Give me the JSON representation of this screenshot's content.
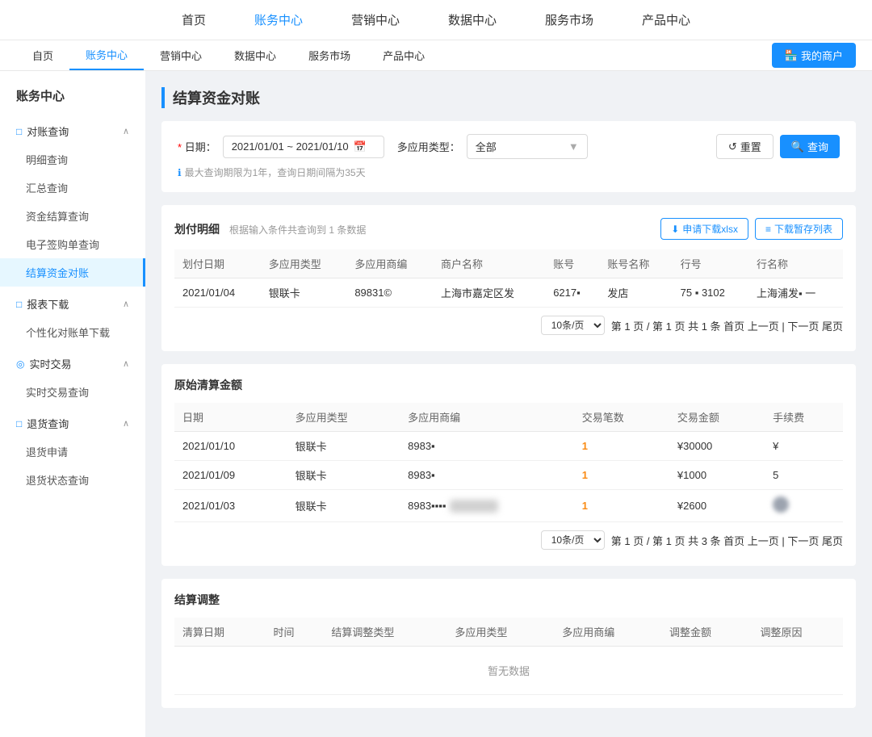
{
  "topNav": {
    "main": [
      {
        "label": "首页",
        "active": false
      },
      {
        "label": "账务中心",
        "active": true
      },
      {
        "label": "营销中心",
        "active": false
      },
      {
        "label": "数据中心",
        "active": false
      },
      {
        "label": "服务市场",
        "active": false
      },
      {
        "label": "产品中心",
        "active": false
      }
    ],
    "sub": [
      {
        "label": "自页",
        "active": false
      },
      {
        "label": "账务中心",
        "active": true
      },
      {
        "label": "营销中心",
        "active": false
      },
      {
        "label": "数据中心",
        "active": false
      },
      {
        "label": "服务市场",
        "active": false
      },
      {
        "label": "产品中心",
        "active": false
      }
    ],
    "myMerchantLabel": "我的商户"
  },
  "sidebar": {
    "title": "账务中心",
    "groups": [
      {
        "icon": "□",
        "label": "对账查询",
        "items": [
          {
            "label": "明细查询",
            "active": false
          },
          {
            "label": "汇总查询",
            "active": false
          },
          {
            "label": "资金结算查询",
            "active": false
          },
          {
            "label": "电子签购单查询",
            "active": false
          },
          {
            "label": "结算资金对账",
            "active": true
          }
        ]
      },
      {
        "icon": "□",
        "label": "报表下载",
        "items": [
          {
            "label": "个性化对账单下载",
            "active": false
          }
        ]
      },
      {
        "icon": "◎",
        "label": "实时交易",
        "items": [
          {
            "label": "实时交易查询",
            "active": false
          }
        ]
      },
      {
        "icon": "□",
        "label": "退货查询",
        "items": [
          {
            "label": "退货申请",
            "active": false
          },
          {
            "label": "退货状态查询",
            "active": false
          }
        ]
      }
    ]
  },
  "page": {
    "title": "结算资金对账",
    "filter": {
      "dateLabel": "日期：",
      "dateRequired": true,
      "dateValue": "2021/01/01 ~ 2021/01/10",
      "appTypeLabel": "多应用类型：",
      "appTypeValue": "全部",
      "hint": "最大查询期限为1年，查询日期间隔为35天",
      "resetLabel": "重置",
      "queryLabel": "查询"
    },
    "paymentDetail": {
      "title": "划付明细",
      "subtitle": "根据输入条件共查询到 1 条数据",
      "downloadXlsxLabel": "申请下载xlsx",
      "downloadSaveLabel": "下载暂存列表",
      "columns": [
        "划付日期",
        "多应用类型",
        "多应用商编",
        "商户名称",
        "账号",
        "账号名称",
        "行号",
        "行名称"
      ],
      "rows": [
        {
          "date": "2021/01/04",
          "appType": "银联卡",
          "appCode": "89831©",
          "merchantName": "上海市嘉定区发",
          "accountNo": "6217▪",
          "accountName": "发店",
          "bankCode": "75  ▪  3102",
          "bankName": "上海浦发▪  一"
        }
      ],
      "pagination": {
        "perPage": "10条/页",
        "info": "第 1 页 / 第 1 页 共 1 条 首页 上一页 | 下一页 尾页"
      }
    },
    "originalSettlement": {
      "title": "原始清算金额",
      "columns": [
        "日期",
        "多应用类型",
        "多应用商编",
        "交易笔数",
        "交易金额",
        "手续费"
      ],
      "rows": [
        {
          "date": "2021/01/10",
          "appType": "银联卡",
          "appCode": "8983▪",
          "tradeCount": "1",
          "tradeAmount": "¥30000",
          "fee": "¥",
          "feeBlurred": false
        },
        {
          "date": "2021/01/09",
          "appType": "银联卡",
          "appCode": "8983▪",
          "tradeCount": "1",
          "tradeAmount": "¥1000",
          "fee": "5",
          "feeBlurred": false
        },
        {
          "date": "2021/01/03",
          "appType": "银联卡",
          "appCode": "8983▪▪▪▪",
          "tradeCount": "1",
          "tradeAmount": "¥2600",
          "fee": "",
          "feeBlurred": true
        }
      ],
      "pagination": {
        "perPage": "10条/页",
        "info": "第 1 页 / 第 1 页 共 3 条 首页 上一页 | 下一页 尾页"
      }
    },
    "settlementAdjust": {
      "title": "结算调整",
      "columns": [
        "清算日期",
        "时间",
        "结算调整类型",
        "多应用类型",
        "多应用商编",
        "调整金额",
        "调整原因"
      ],
      "noData": "暂无数据"
    }
  }
}
